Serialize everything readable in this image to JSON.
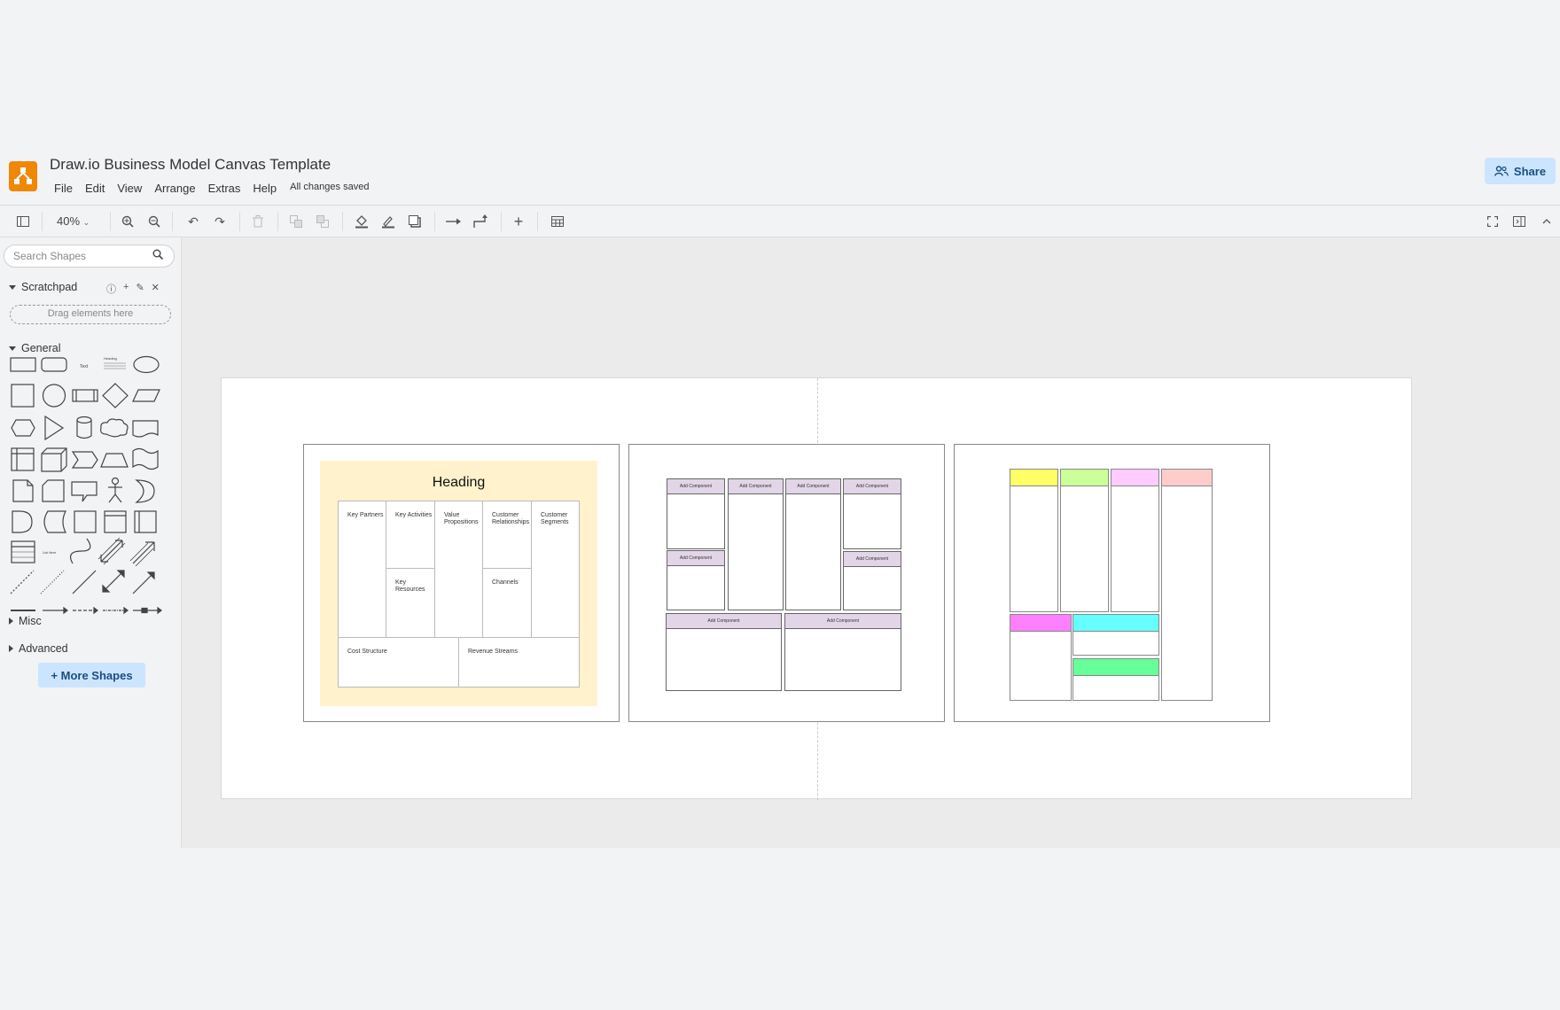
{
  "header": {
    "title": "Draw.io Business Model Canvas Template",
    "menu": [
      "File",
      "Edit",
      "View",
      "Arrange",
      "Extras",
      "Help"
    ],
    "status": "All changes saved",
    "share_label": "Share"
  },
  "toolbar": {
    "zoom": "40%"
  },
  "sidebar": {
    "search_placeholder": "Search Shapes",
    "scratchpad_label": "Scratchpad",
    "drag_hint": "Drag elements here",
    "general_label": "General",
    "misc_label": "Misc",
    "advanced_label": "Advanced",
    "more_shapes_label": "+ More Shapes",
    "shape_text_label": "Text",
    "shape_heading_label": "Heading",
    "shape_list_label": "List Item"
  },
  "canvas": {
    "bmc": {
      "heading": "Heading",
      "key_partners": "Key Partners",
      "key_activities": "Key Activities",
      "value_propositions": "Value Propositions",
      "customer_relationships": "Customer Relationships",
      "customer_segments": "Customer Segments",
      "key_resources": "Key Resources",
      "channels": "Channels",
      "cost_structure": "Cost Structure",
      "revenue_streams": "Revenue Streams",
      "bg_color": "#fff2cc"
    },
    "components": {
      "label": "Add Component",
      "header_color": "#e1d5e7"
    },
    "sticky_colors": {
      "yellow": "#ffff66",
      "green": "#ccff99",
      "pink": "#ffccff",
      "salmon": "#ffcccc",
      "magenta": "#ff80ff",
      "cyan": "#66ffff",
      "mint": "#66ff99"
    }
  }
}
